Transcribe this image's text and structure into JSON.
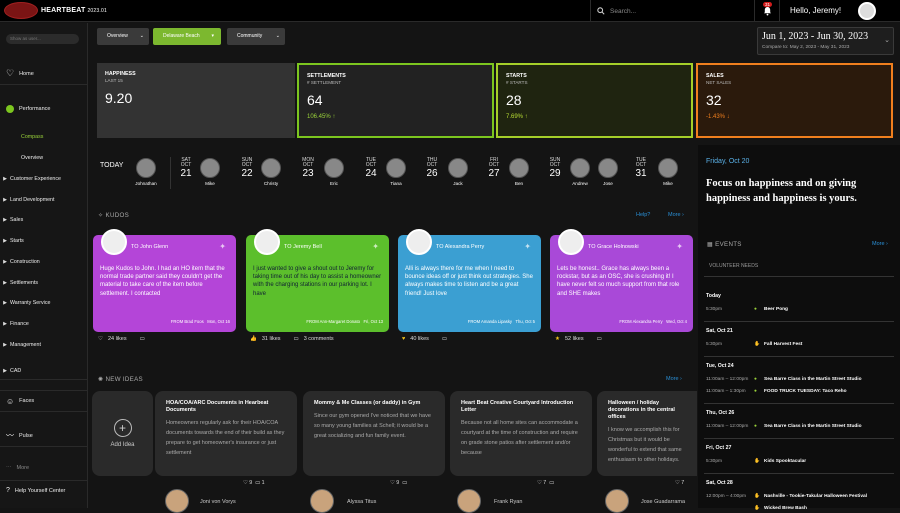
{
  "app": {
    "brand": "HEARTBEAT",
    "version": "2023.01",
    "search_placeholder": "Search...",
    "notif_count": "31",
    "greeting": "Hello, Jeremy!"
  },
  "sidebar": {
    "search_placeholder": "Show as user...",
    "items": [
      {
        "label": "Home"
      },
      {
        "label": "Performance"
      },
      {
        "label": "Compass"
      },
      {
        "label": "Overview"
      },
      {
        "label": "Customer Experience"
      },
      {
        "label": "Land Development"
      },
      {
        "label": "Sales"
      },
      {
        "label": "Starts"
      },
      {
        "label": "Construction"
      },
      {
        "label": "Settlements"
      },
      {
        "label": "Warranty Service"
      },
      {
        "label": "Finance"
      },
      {
        "label": "Management"
      },
      {
        "label": "CAD"
      },
      {
        "label": "Faces"
      },
      {
        "label": "Pulse"
      },
      {
        "label": "More"
      },
      {
        "label": "Help Yourself Center"
      }
    ]
  },
  "filters": {
    "overview": "Overview",
    "community_group": "Delaware Beach",
    "community": "Community"
  },
  "daterange": {
    "main": "Jun 1, 2023 - Jun 30, 2023",
    "compare": "Compare to: May 2, 2023 - May 31, 2023"
  },
  "kpis": [
    {
      "label": "HAPPINESS",
      "sub": "LAST 15",
      "value": "9.20",
      "delta": ""
    },
    {
      "label": "SETTLEMENTS",
      "sub": "# SETTLEMENT",
      "value": "64",
      "delta": "106.45% ↑"
    },
    {
      "label": "STARTS",
      "sub": "# STARTS",
      "value": "28",
      "delta": "7.69% ↑"
    },
    {
      "label": "SALES",
      "sub": "NET SALES",
      "value": "32",
      "delta": "-1.43% ↓"
    }
  ],
  "calendar": {
    "today": "TODAY",
    "days": [
      {
        "dow": "SAT",
        "mon": "OCT",
        "day": "21"
      },
      {
        "dow": "SUN",
        "mon": "OCT",
        "day": "22"
      },
      {
        "dow": "MON",
        "mon": "OCT",
        "day": "23"
      },
      {
        "dow": "TUE",
        "mon": "OCT",
        "day": "24"
      },
      {
        "dow": "THU",
        "mon": "OCT",
        "day": "26"
      },
      {
        "dow": "FRI",
        "mon": "OCT",
        "day": "27"
      },
      {
        "dow": "SUN",
        "mon": "OCT",
        "day": "29"
      },
      {
        "dow": "TUE",
        "mon": "OCT",
        "day": "31"
      }
    ],
    "people": [
      "Johnathan",
      "Mike",
      "Christy",
      "Eric",
      "Tiana",
      "Jack",
      "Ben",
      "Andrew",
      "Jose",
      "Mike"
    ]
  },
  "motto": {
    "date": "Friday, Oct 20",
    "text": "Focus on happiness and on giving happiness and happiness is yours."
  },
  "kudos": {
    "heading": "KUDOS",
    "help": "Help?",
    "more": "More",
    "cards": [
      {
        "to": "John Glenn",
        "body": "Huge Kudos to John. I had an HO item that the normal trade partner said they couldn't get the material to take care of the item before settlement. I contacted",
        "from": "Brad Foos",
        "date": "Mon, Oct 16",
        "likes": "24 likes",
        "comments": ""
      },
      {
        "to": "Jeremy Bell",
        "body": "I just wanted to give a shout out to Jeremy for taking time out of his day to assist a homeowner with the charging stations in our parking lot. I have",
        "from": "Ann-Margaret Donato",
        "date": "Fri, Oct 13",
        "likes": "31 likes",
        "comments": "3 comments"
      },
      {
        "to": "Alexandra Perry",
        "body": "Alli is always there for me when I need to bounce ideas off or just think out strategies. She always makes time to listen and be a great friend! Just love",
        "from": "Amanda Lipasky",
        "date": "Thu, Oct 5",
        "likes": "40 likes",
        "comments": ""
      },
      {
        "to": "Grace Holnowski",
        "body": "Lets be honest.. Grace has always been a rockstar, but as an OSC, she is crushing it! I have never felt so much support from that role and SHE makes",
        "from": "Alexandra Perry",
        "date": "Wed, Oct 4",
        "likes": "52 likes",
        "comments": ""
      }
    ]
  },
  "ideas": {
    "heading": "NEW IDEAS",
    "more": "More",
    "add": "Add Idea",
    "cards": [
      {
        "title": "HOA/COA/ARC Documents in Hearbeat Documents",
        "body": "Homeowners regularly ask for their HOA/COA documents towards the end of their build as they prepare to get homeowner's insurance or just settlement",
        "likes": "9",
        "comments": "1",
        "author": "Joni von Vorys"
      },
      {
        "title": "Mommy & Me Classes (or daddy) in Gym",
        "body": "Since our gym opened I've noticed that we have so many young families at Schell; it would be a great socializing and fun family event.",
        "likes": "9",
        "comments": "",
        "author": "Alyssa Titus"
      },
      {
        "title": "Heart Beat Creative Courtyard Introduction Letter",
        "body": "Because not all home sites can accommodate a courtyard at the time of construction and require on grade stone patios after settlement and/or because",
        "likes": "7",
        "comments": "",
        "author": "Frank Ryan"
      },
      {
        "title": "Halloween / holiday decorations in the central offices",
        "body": "I know we accomplish this for Christmas but it would be wonderful to extend that same enthusiasm to other holidays. Halloween. Decorations can affect",
        "likes": "7",
        "comments": "",
        "author": "Jose Guadarrama"
      }
    ]
  },
  "events": {
    "heading": "EVENTS",
    "more": "More",
    "category": "VOLUNTEER NEEDS",
    "items": [
      {
        "date": "Today",
        "rows": [
          {
            "time": "5:30pm",
            "name": "Beer Pong",
            "mark": "dot"
          }
        ]
      },
      {
        "date": "Sat, Oct 21",
        "rows": [
          {
            "time": "5:30pm",
            "name": "Fall Harvest Fest",
            "mark": "hand"
          }
        ]
      },
      {
        "date": "Tue, Oct 24",
        "rows": [
          {
            "time": "11:00am – 12:00pm",
            "name": "Sea Barre Class in the Martin Street Studio",
            "mark": "dot"
          },
          {
            "time": "11:00am – 1:30pm",
            "name": "FOOD TRUCK TUESDAY: Taco Reho",
            "mark": "dot"
          }
        ]
      },
      {
        "date": "Thu, Oct 26",
        "rows": [
          {
            "time": "11:00am – 12:00pm",
            "name": "Sea Barre Class in the Martin Street Studio",
            "mark": "dot"
          }
        ]
      },
      {
        "date": "Fri, Oct 27",
        "rows": [
          {
            "time": "5:30pm",
            "name": "Kids Spooktacular",
            "mark": "hand"
          }
        ]
      },
      {
        "date": "Sat, Oct 28",
        "rows": [
          {
            "time": "12:00pm – 4:00pm",
            "name": "Nashville - Tookie-Takular Halloween Festival",
            "mark": "hand"
          },
          {
            "time": "",
            "name": "Wicked Brew Bash",
            "mark": "hand"
          }
        ]
      }
    ]
  },
  "colors": {
    "settlements": "#7cc61f",
    "starts": "#a5cf29",
    "sales": "#f07f1e",
    "kudo1": "#b445d8",
    "kudo2": "#5cbf2c",
    "kudo3": "#3b9fd2",
    "kudo4": "#a949d8"
  }
}
